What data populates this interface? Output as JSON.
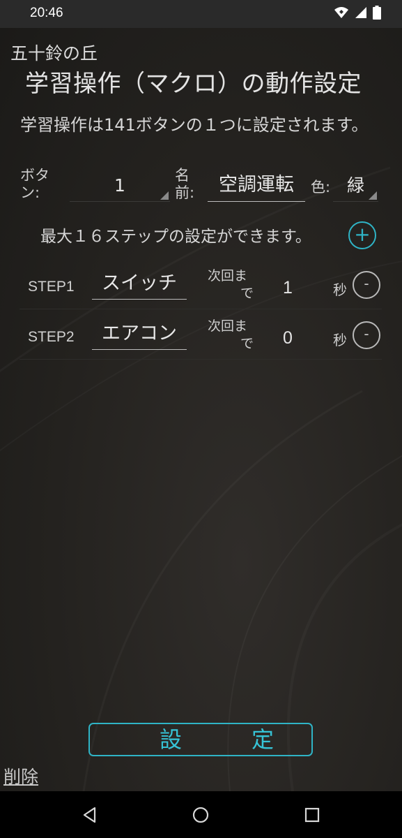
{
  "status_bar": {
    "time": "20:46",
    "icons": [
      "wifi-icon",
      "signal-icon",
      "battery-icon"
    ]
  },
  "header": {
    "app_name": "五十鈴の丘",
    "title": "学習操作（マクロ）の動作設定"
  },
  "description": "学習操作は141ボタンの１つに設定されます。",
  "fields": {
    "button_label_line1": "ボタ",
    "button_label_line2": "ン:",
    "button_value": "1",
    "name_label_line1": "名",
    "name_label_line2": "前:",
    "name_value": "空調運転",
    "color_label": "色:",
    "color_value": "緑"
  },
  "steps_info": "最大１６ステップの設定ができます。",
  "steps": [
    {
      "label": "STEP1",
      "name": "スイッチ",
      "next_label_line1": "次回ま",
      "next_label_line2": "で",
      "seconds": "1",
      "unit": "秒"
    },
    {
      "label": "STEP2",
      "name": "エアコン",
      "next_label_line1": "次回ま",
      "next_label_line2": "で",
      "seconds": "0",
      "unit": "秒"
    }
  ],
  "buttons": {
    "add_symbol": "+",
    "remove_symbol": "-",
    "set_label": "設定",
    "delete_label": "削除"
  },
  "colors": {
    "accent": "#2fb4c6",
    "background": "#24221f",
    "text": "#d9d9d9"
  }
}
